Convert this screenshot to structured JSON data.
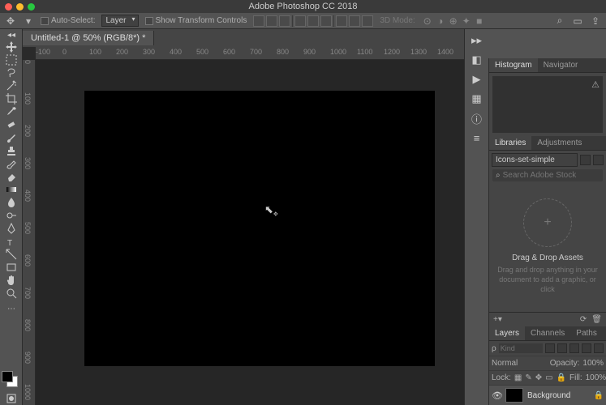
{
  "titlebar": {
    "title": "Adobe Photoshop CC 2018"
  },
  "options": {
    "auto_select_label": "Auto-Select:",
    "auto_select_value": "Layer",
    "show_transform_label": "Show Transform Controls",
    "mode_3d_label": "3D Mode:"
  },
  "tab": {
    "label": "Untitled-1 @ 50% (RGB/8*) *"
  },
  "ruler_h": [
    "-100",
    "0",
    "100",
    "200",
    "300",
    "400",
    "500",
    "600",
    "700",
    "800",
    "900",
    "1000",
    "1100",
    "1200",
    "1300",
    "1400"
  ],
  "ruler_v": [
    "0",
    "100",
    "200",
    "300",
    "400",
    "500",
    "600",
    "700",
    "800",
    "900",
    "1000"
  ],
  "panels": {
    "histo_tabs": [
      "Histogram",
      "Navigator"
    ],
    "lib_tabs": [
      "Libraries",
      "Adjustments"
    ],
    "lib_select": "Icons-set-simple",
    "search_placeholder": "Search Adobe Stock",
    "drop_title": "Drag & Drop Assets",
    "drop_sub": "Drag and drop anything in your document to add a graphic, or click",
    "layer_tabs": [
      "Layers",
      "Channels",
      "Paths"
    ],
    "kind_placeholder": "Kind",
    "blend_mode": "Normal",
    "opacity_label": "Opacity:",
    "opacity_val": "100%",
    "lock_label": "Lock:",
    "fill_label": "Fill:",
    "fill_val": "100%",
    "layer_name": "Background"
  }
}
